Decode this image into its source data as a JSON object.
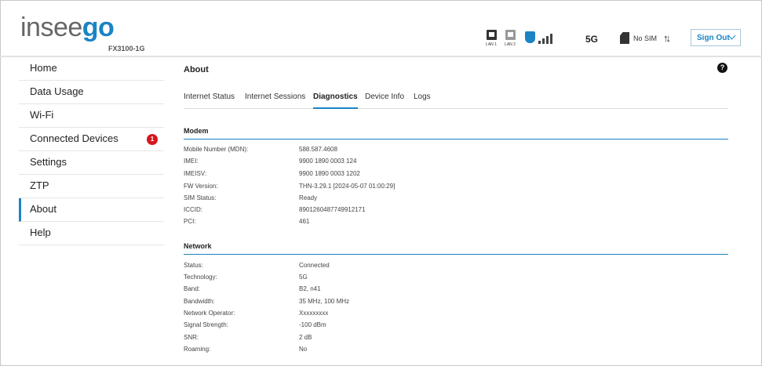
{
  "header": {
    "logo_part1": "insee",
    "logo_part2": "go",
    "model": "FX3100-1G",
    "lan1_label": "LAN 1",
    "lan2_label": "LAN 2",
    "network_type": "5G",
    "sim_status": "No SIM",
    "signout_label": "Sign Out",
    "accent_color": "#1a84c4"
  },
  "sidebar": {
    "items": [
      {
        "label": "Home"
      },
      {
        "label": "Data Usage"
      },
      {
        "label": "Wi-Fi"
      },
      {
        "label": "Connected Devices",
        "badge": "1"
      },
      {
        "label": "Settings"
      },
      {
        "label": "ZTP"
      },
      {
        "label": "About",
        "active": true
      },
      {
        "label": "Help"
      }
    ]
  },
  "main": {
    "title": "About",
    "help_glyph": "?",
    "tabs": [
      {
        "label": "Internet Status"
      },
      {
        "label": "Internet Sessions"
      },
      {
        "label": "Diagnostics",
        "active": true
      },
      {
        "label": "Device Info"
      },
      {
        "label": "Logs"
      }
    ],
    "modem": {
      "title": "Modem",
      "rows": [
        {
          "key": "Mobile Number (MDN):",
          "value": "588.587.4608"
        },
        {
          "key": "IMEI:",
          "value": "9900 1890 0003 124"
        },
        {
          "key": "IMEISV:",
          "value": "9900 1890 0003 1202"
        },
        {
          "key": "FW Version:",
          "value": "THN-3.29.1 [2024-05-07 01:00:29]"
        },
        {
          "key": "SIM Status:",
          "value": "Ready"
        },
        {
          "key": "ICCID:",
          "value": "8901260487749912171"
        },
        {
          "key": "PCI:",
          "value": "461"
        }
      ]
    },
    "network": {
      "title": "Network",
      "rows": [
        {
          "key": "Status:",
          "value": "Connected"
        },
        {
          "key": "Technology:",
          "value": "5G"
        },
        {
          "key": "Band:",
          "value": "B2, n41"
        },
        {
          "key": "Bandwidth:",
          "value": "35 MHz, 100 MHz"
        },
        {
          "key": "Network Operator:",
          "value": "Xxxxxxxxx"
        },
        {
          "key": "Signal Strength:",
          "value": "-100 dBm"
        },
        {
          "key": "SNR:",
          "value": "2 dB"
        },
        {
          "key": "Roaming:",
          "value": "No"
        }
      ]
    }
  }
}
